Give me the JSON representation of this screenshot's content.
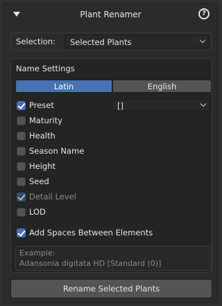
{
  "panel": {
    "title": "Plant Renamer",
    "help_icon_glyph": "?"
  },
  "selection": {
    "label": "Selection:",
    "value": "Selected Plants"
  },
  "name_settings": {
    "title": "Name Settings",
    "language_tabs": [
      {
        "label": "Latin",
        "active": true
      },
      {
        "label": "English",
        "active": false
      }
    ],
    "preset_dropdown_value": "[]",
    "options": [
      {
        "label": "Preset",
        "checked": true,
        "enabled": true
      },
      {
        "label": "Maturity",
        "checked": false,
        "enabled": true
      },
      {
        "label": "Health",
        "checked": false,
        "enabled": true
      },
      {
        "label": "Season Name",
        "checked": false,
        "enabled": true
      },
      {
        "label": "Height",
        "checked": false,
        "enabled": true
      },
      {
        "label": "Seed",
        "checked": false,
        "enabled": true
      },
      {
        "label": "Detail Level",
        "checked": true,
        "enabled": false
      },
      {
        "label": "LOD",
        "checked": false,
        "enabled": true
      }
    ],
    "add_spaces": {
      "label": "Add Spaces Between Elements",
      "checked": true
    },
    "example": {
      "label": "Example:",
      "value": "Adansonia digitata HD [Standard (0)]"
    }
  },
  "rename_button": "Rename Selected Plants",
  "colors": {
    "accent": "#4772b3",
    "background": "#303030"
  }
}
